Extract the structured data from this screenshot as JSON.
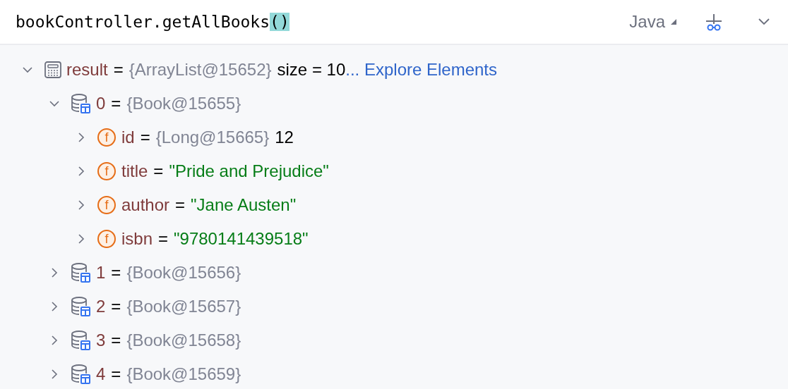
{
  "header": {
    "expression": "bookController.getAllBooks",
    "highlighted": "()",
    "language": "Java"
  },
  "tree": [
    {
      "kind": "result",
      "expanded": true,
      "name": "result",
      "sep": "=",
      "type": "{ArrayList@15652}",
      "value": {
        "kind": "plain",
        "text": "size = 10"
      },
      "link": "... Explore Elements",
      "children": [
        {
          "kind": "object",
          "expanded": true,
          "name": "0",
          "sep": "=",
          "type": "{Book@15655}",
          "children": [
            {
              "kind": "field",
              "icon_text": "f",
              "expanded": false,
              "name": "id",
              "sep": "=",
              "type": "{Long@15665}",
              "value": {
                "kind": "plain",
                "text": "12"
              }
            },
            {
              "kind": "field",
              "icon_text": "f",
              "expanded": false,
              "name": "title",
              "sep": "=",
              "value": {
                "kind": "string",
                "text": "\"Pride and Prejudice\""
              }
            },
            {
              "kind": "field",
              "icon_text": "f",
              "expanded": false,
              "name": "author",
              "sep": "=",
              "value": {
                "kind": "string",
                "text": "\"Jane Austen\""
              }
            },
            {
              "kind": "field",
              "icon_text": "f",
              "expanded": false,
              "name": "isbn",
              "sep": "=",
              "value": {
                "kind": "string",
                "text": "\"9780141439518\""
              }
            }
          ]
        },
        {
          "kind": "object",
          "expanded": false,
          "name": "1",
          "sep": "=",
          "type": "{Book@15656}"
        },
        {
          "kind": "object",
          "expanded": false,
          "name": "2",
          "sep": "=",
          "type": "{Book@15657}"
        },
        {
          "kind": "object",
          "expanded": false,
          "name": "3",
          "sep": "=",
          "type": "{Book@15658}"
        },
        {
          "kind": "object",
          "expanded": false,
          "name": "4",
          "sep": "=",
          "type": "{Book@15659}"
        }
      ]
    }
  ]
}
